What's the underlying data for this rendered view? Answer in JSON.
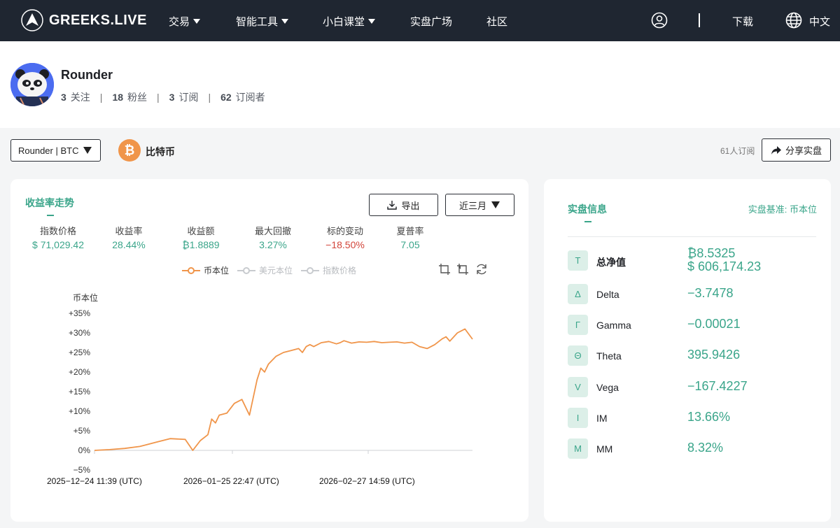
{
  "nav": {
    "brand": "GREEKS.LIVE",
    "items": [
      {
        "label": "交易",
        "dropdown": true
      },
      {
        "label": "智能工具",
        "dropdown": true
      },
      {
        "label": "小白课堂",
        "dropdown": true
      },
      {
        "label": "实盘广场",
        "dropdown": false
      },
      {
        "label": "社区",
        "dropdown": false
      }
    ],
    "download": "下载",
    "language": "中文"
  },
  "profile": {
    "name": "Rounder",
    "following": "3",
    "following_label": "关注",
    "followers": "18",
    "followers_label": "粉丝",
    "subscriptions": "3",
    "subscriptions_label": "订阅",
    "subscribers": "62",
    "subscribers_label": "订阅者"
  },
  "controls": {
    "account": "Rounder | BTC",
    "coin_symbol": "₿",
    "coin_name": "比特币",
    "subscribed_count": "61人订阅",
    "share_label": "分享实盘"
  },
  "performance": {
    "title": "收益率走势",
    "export_label": "导出",
    "range_label": "近三月",
    "metrics": [
      {
        "label": "指数价格",
        "value": "$ 71,029.42",
        "negative": false
      },
      {
        "label": "收益率",
        "value": "28.44%",
        "negative": false
      },
      {
        "label": "收益额",
        "value": "₿1.8889",
        "negative": false
      },
      {
        "label": "最大回撤",
        "value": "3.27%",
        "negative": false
      },
      {
        "label": "标的变动",
        "value": "−18.50%",
        "negative": true
      },
      {
        "label": "夏普率",
        "value": "7.05",
        "negative": false
      }
    ],
    "legend": [
      {
        "label": "币本位",
        "active": true,
        "color": "#f0954a"
      },
      {
        "label": "美元本位",
        "active": false,
        "color": "#c8cbcf"
      },
      {
        "label": "指数价格",
        "active": false,
        "color": "#c8cbcf"
      }
    ]
  },
  "chart_data": {
    "type": "line",
    "ylabel": "币本位",
    "ylim": [
      -5,
      35
    ],
    "yticks": [
      "+35%",
      "+30%",
      "+25%",
      "+20%",
      "+15%",
      "+10%",
      "+5%",
      "0%",
      "−5%"
    ],
    "xticks": [
      "2025−12−24 11:39 (UTC)",
      "2026−01−25 22:47 (UTC)",
      "2026−02−27 14:59 (UTC)"
    ],
    "series": [
      {
        "color": "#f0954a",
        "x": [
          0,
          4,
          8,
          12,
          16,
          20,
          24,
          26,
          28,
          30,
          31,
          32,
          33,
          35,
          37,
          39,
          41,
          43,
          44,
          45,
          46,
          48,
          50,
          52,
          54,
          55,
          56,
          57,
          58,
          60,
          62,
          64,
          65,
          66,
          68,
          70,
          72,
          74,
          76,
          78,
          80,
          82,
          84,
          86,
          88,
          90,
          92,
          93,
          94,
          96,
          98,
          100
        ],
        "values": [
          0,
          0.2,
          0.5,
          1,
          2,
          3,
          2.8,
          0,
          2.5,
          4,
          8,
          7,
          9,
          9.5,
          12,
          13,
          9,
          18,
          21,
          20,
          22,
          24,
          25,
          25.5,
          26,
          25,
          26.5,
          27,
          26.5,
          27.5,
          27.8,
          27.2,
          27.5,
          28,
          27.4,
          27.7,
          27.6,
          27.8,
          27.5,
          27.6,
          27.7,
          27.4,
          27.6,
          26.5,
          26,
          27,
          28.5,
          29,
          27.9,
          30,
          31,
          28.4
        ]
      }
    ]
  },
  "info": {
    "title": "实盘信息",
    "basis": "实盘基准: 币本位",
    "net_value_label": "总净值",
    "net_value_btc": "₿8.5325",
    "net_value_usd": "$ 606,174.23",
    "greeks": [
      {
        "symbol": "T",
        "name": "总净值"
      },
      {
        "symbol": "Δ",
        "name": "Delta",
        "value": "−3.7478"
      },
      {
        "symbol": "Γ",
        "name": "Gamma",
        "value": "−0.00021"
      },
      {
        "symbol": "Θ",
        "name": "Theta",
        "value": "395.9426"
      },
      {
        "symbol": "V",
        "name": "Vega",
        "value": "−167.4227"
      },
      {
        "symbol": "I",
        "name": "IM",
        "value": "13.66%"
      },
      {
        "symbol": "M",
        "name": "MM",
        "value": "8.32%"
      }
    ]
  }
}
